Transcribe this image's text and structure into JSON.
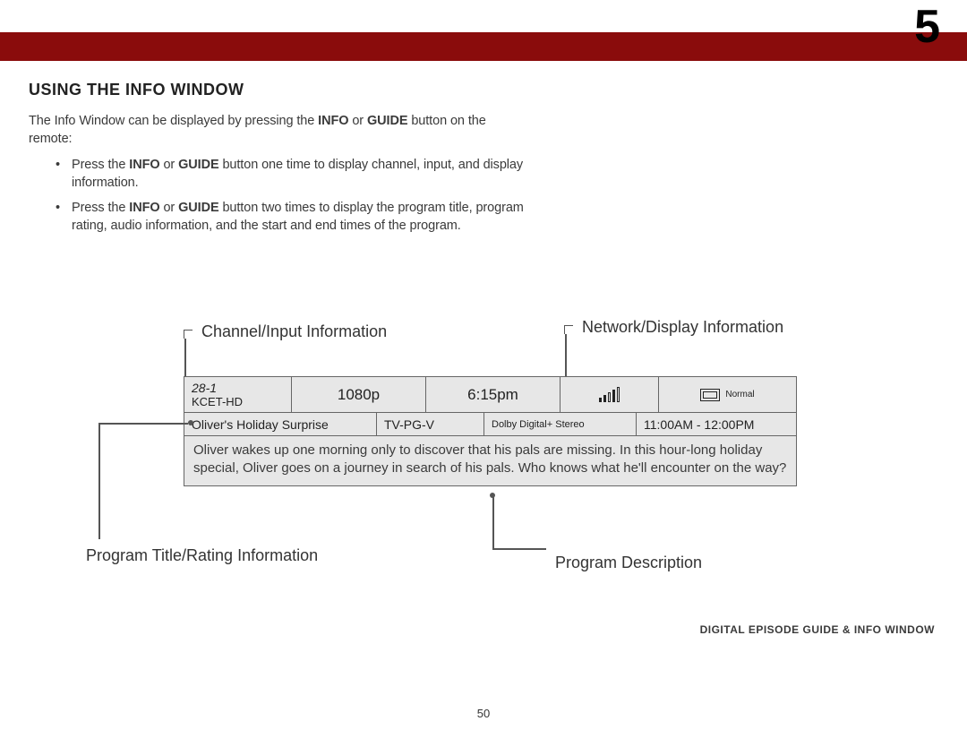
{
  "chapter_number": "5",
  "section_title": "USING THE INFO WINDOW",
  "intro_html": "The Info Window can be displayed by pressing the <b>INFO</b> or <b>GUIDE</b> button on the remote:",
  "bullets": [
    "Press the <b>INFO</b> or <b>GUIDE</b> button one time to display channel, input, and display information.",
    "Press the <b>INFO</b> or <b>GUIDE</b> button two times to display the program title, program rating, audio information, and the start and end times of the program."
  ],
  "labels": {
    "channel_input": "Channel/Input Information",
    "network_display": "Network/Display Information",
    "program_title_rating": "Program Title/Rating Information",
    "program_description": "Program Description"
  },
  "info": {
    "channel_number": "28-1",
    "channel_name": "KCET-HD",
    "resolution": "1080p",
    "time": "6:15pm",
    "display_mode": "Normal",
    "program_title": "Oliver's Holiday Surprise",
    "rating": "TV-PG-V",
    "audio": "Dolby Digital+ Stereo",
    "program_times": "11:00AM - 12:00PM",
    "description": "Oliver wakes up one morning only to discover that his pals are missing. In this hour-long holiday special, Oliver goes on a journey in search of his pals. Who knows what he'll encounter on the way?"
  },
  "footer_label": "DIGITAL EPISODE GUIDE & INFO WINDOW",
  "page_number": "50"
}
